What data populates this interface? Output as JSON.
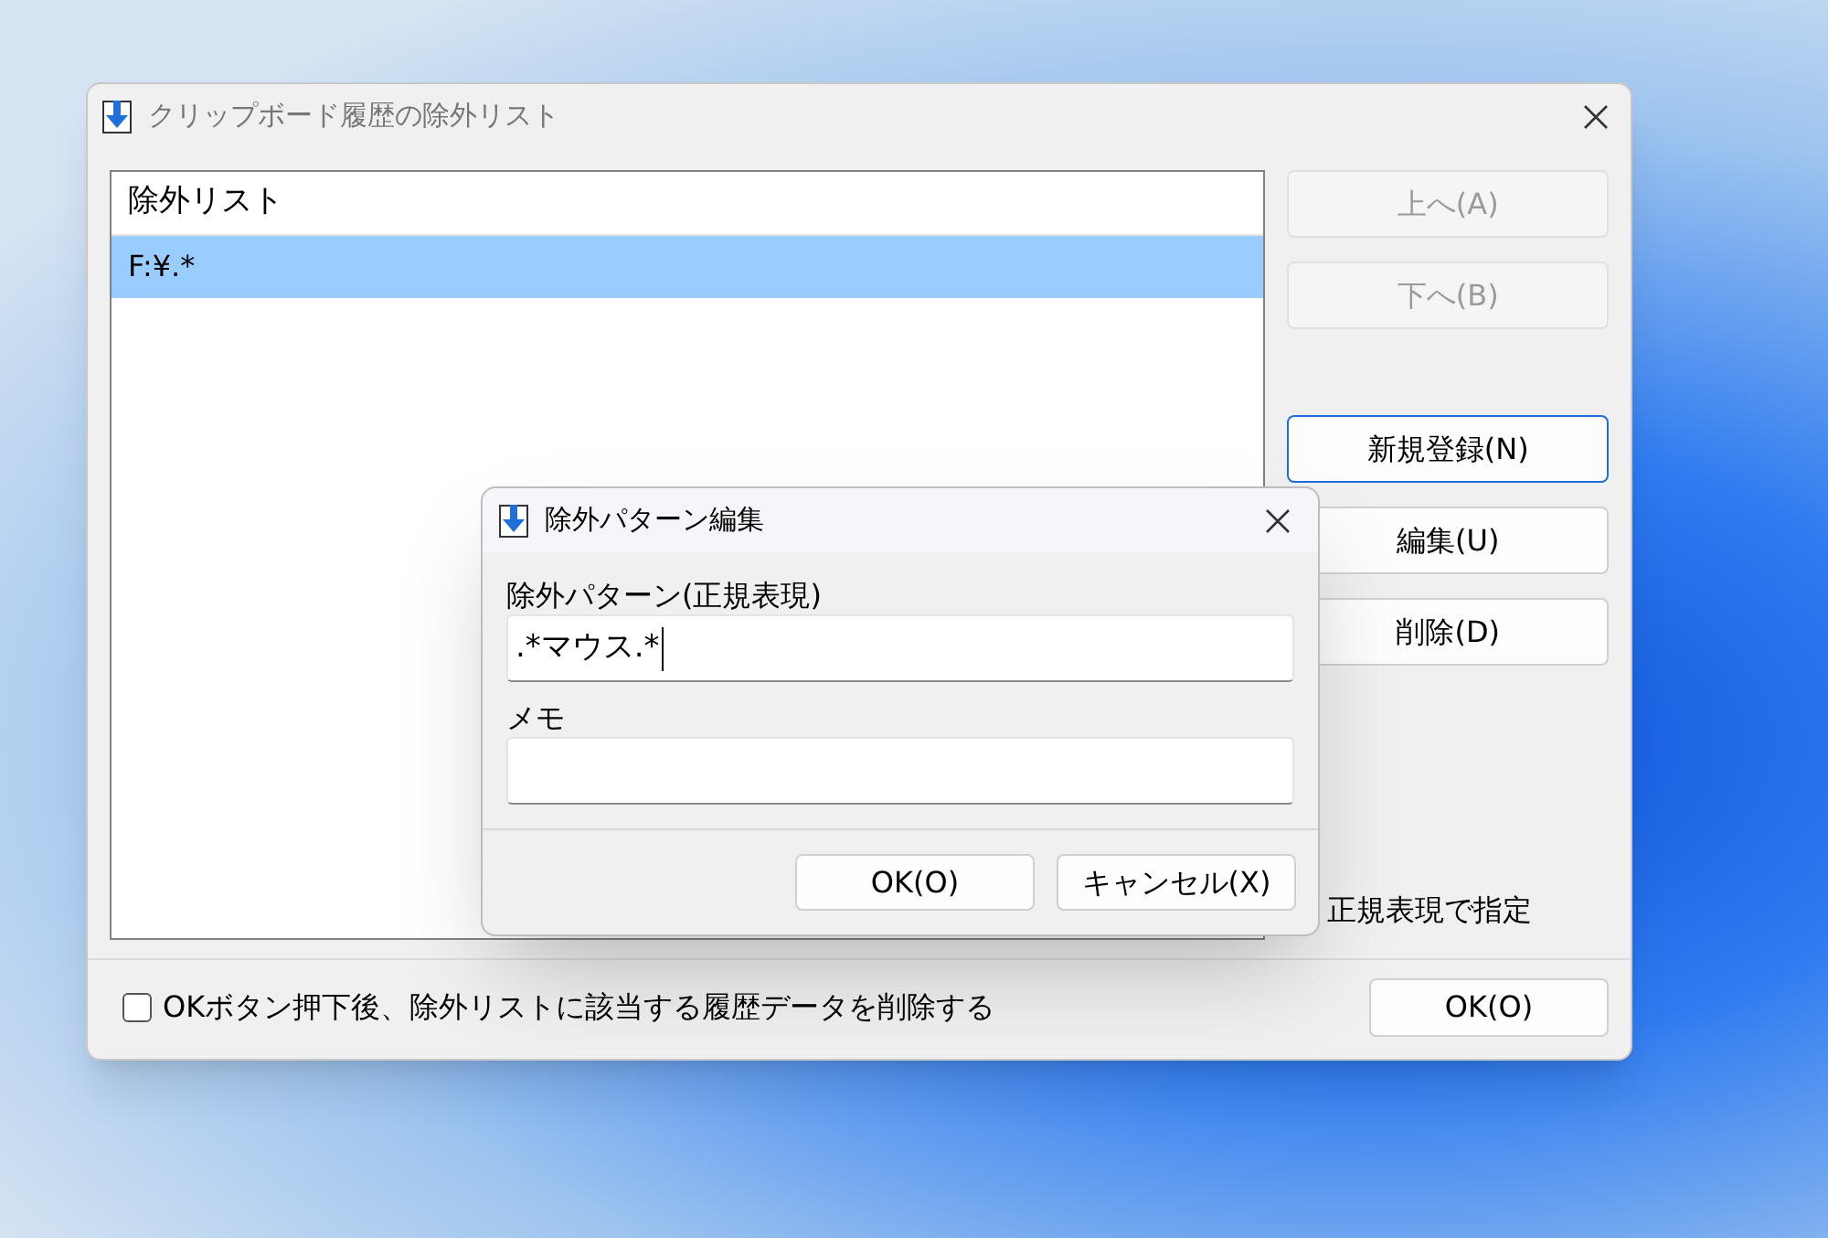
{
  "window": {
    "title": "クリップボード履歴の除外リスト"
  },
  "list": {
    "header": "除外リスト",
    "rows": [
      {
        "text": "F:¥.*",
        "selected": true
      }
    ]
  },
  "side_buttons": [
    {
      "label": "上へ(A)",
      "disabled": true,
      "focused": false
    },
    {
      "label": "下へ(B)",
      "disabled": true,
      "focused": false
    },
    {
      "label": "新規登録(N)",
      "disabled": false,
      "focused": true
    },
    {
      "label": "編集(U)",
      "disabled": false,
      "focused": false
    },
    {
      "label": "削除(D)",
      "disabled": false,
      "focused": false
    }
  ],
  "partial_label": "正規表現で指定",
  "footer": {
    "checkbox": {
      "label": "OKボタン押下後、除外リストに該当する履歴データを削除する",
      "checked": false
    },
    "ok": "OK(O)"
  },
  "dialog": {
    "title": "除外パターン編集",
    "fields": [
      {
        "label": "除外パターン(正規表現)",
        "value": ".*マウス.*",
        "focused": true
      },
      {
        "label": "メモ",
        "focused": false
      }
    ],
    "buttons": [
      "OK(O)",
      "キャンセル(X)"
    ]
  }
}
